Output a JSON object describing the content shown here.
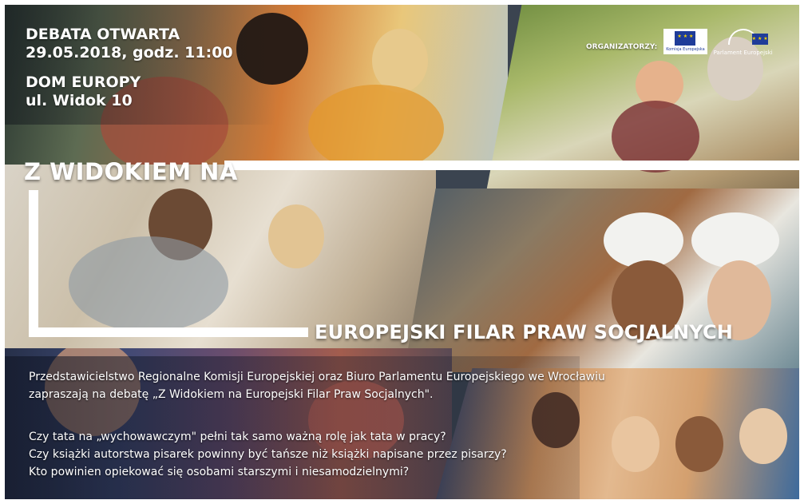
{
  "event": {
    "line1": "DEBATA OTWARTA",
    "line2": "29.05.2018, godz. 11:00",
    "line3": "DOM EUROPY",
    "line4": "ul. Widok 10"
  },
  "organizers": {
    "label": "ORGANIZATORZY:",
    "logo_ec_caption": "Komisja Europejska",
    "logo_ep_caption": "Parlament Europejski"
  },
  "title": {
    "main": "Z WIDOKIEM NA",
    "sub": "EUROPEJSKI FILAR PRAW SOCJALNYCH"
  },
  "invitation": {
    "line1": "Przedstawicielstwo Regionalne Komisji Europejskiej oraz Biuro Parlamentu Europejskiego we Wrocławiu",
    "line2": "zapraszają na debatę „Z Widokiem na Europejski Filar Praw Socjalnych\"."
  },
  "questions": [
    "Czy tata na „wychowawczym\" pełni tak samo ważną rolę jak tata w pracy?",
    "Czy książki autorstwa pisarek powinny być tańsze niż książki napisane przez pisarzy?",
    "Kto powinien opiekować się osobami starszymi i niesamodzielnymi?"
  ],
  "colors": {
    "text": "#ffffff",
    "eu_blue": "#1f3c99",
    "eu_gold": "#f5d200"
  }
}
